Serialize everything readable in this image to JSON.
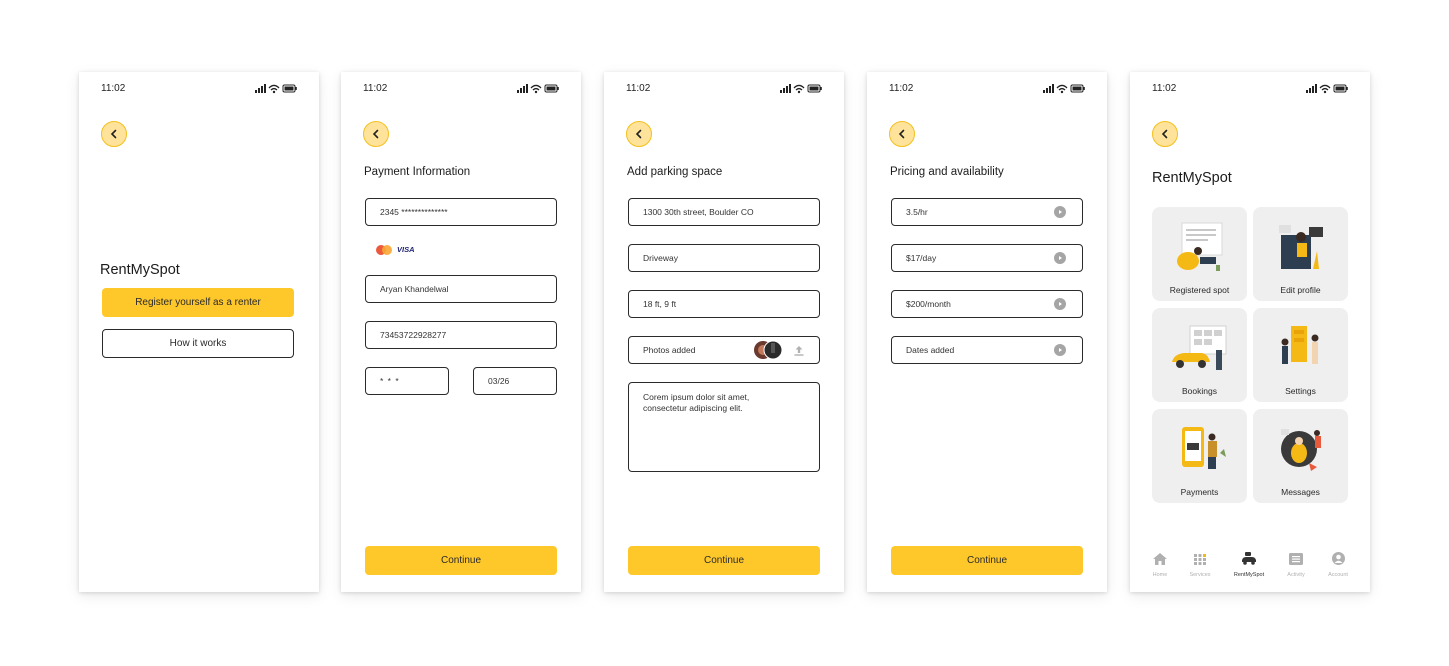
{
  "status_time": "11:02",
  "screen1": {
    "app_name": "RentMySpot",
    "register_label": "Register yourself as a renter",
    "how_label": "How it works"
  },
  "screen2": {
    "title": "Payment Information",
    "card_number": "2345 **************",
    "card_brand": "VISA",
    "name": "Aryan Khandelwal",
    "account_number": "73453722928277",
    "cvv": "* * *",
    "expiry": "03/26",
    "continue_label": "Continue"
  },
  "screen3": {
    "title": "Add parking space",
    "address": "1300 30th street, Boulder CO",
    "type": "Driveway",
    "size": "18 ft, 9 ft",
    "photos": "Photos added",
    "description": "Corem ipsum dolor sit amet, consectetur adipiscing elit.",
    "continue_label": "Continue"
  },
  "screen4": {
    "title": "Pricing and availability",
    "hourly": "3.5/hr",
    "daily": "$17/day",
    "monthly": "$200/month",
    "dates": "Dates added",
    "continue_label": "Continue"
  },
  "screen5": {
    "title": "RentMySpot",
    "cards": [
      "Registered spot",
      "Edit profile",
      "Bookings",
      "Settings",
      "Payments",
      "Messages"
    ],
    "nav": [
      "Home",
      "Services",
      "RentMySpot",
      "Activity",
      "Account"
    ]
  },
  "colors": {
    "accent": "#ffc82a",
    "back_fill": "#ffe39a",
    "card_bg": "#efefef"
  }
}
